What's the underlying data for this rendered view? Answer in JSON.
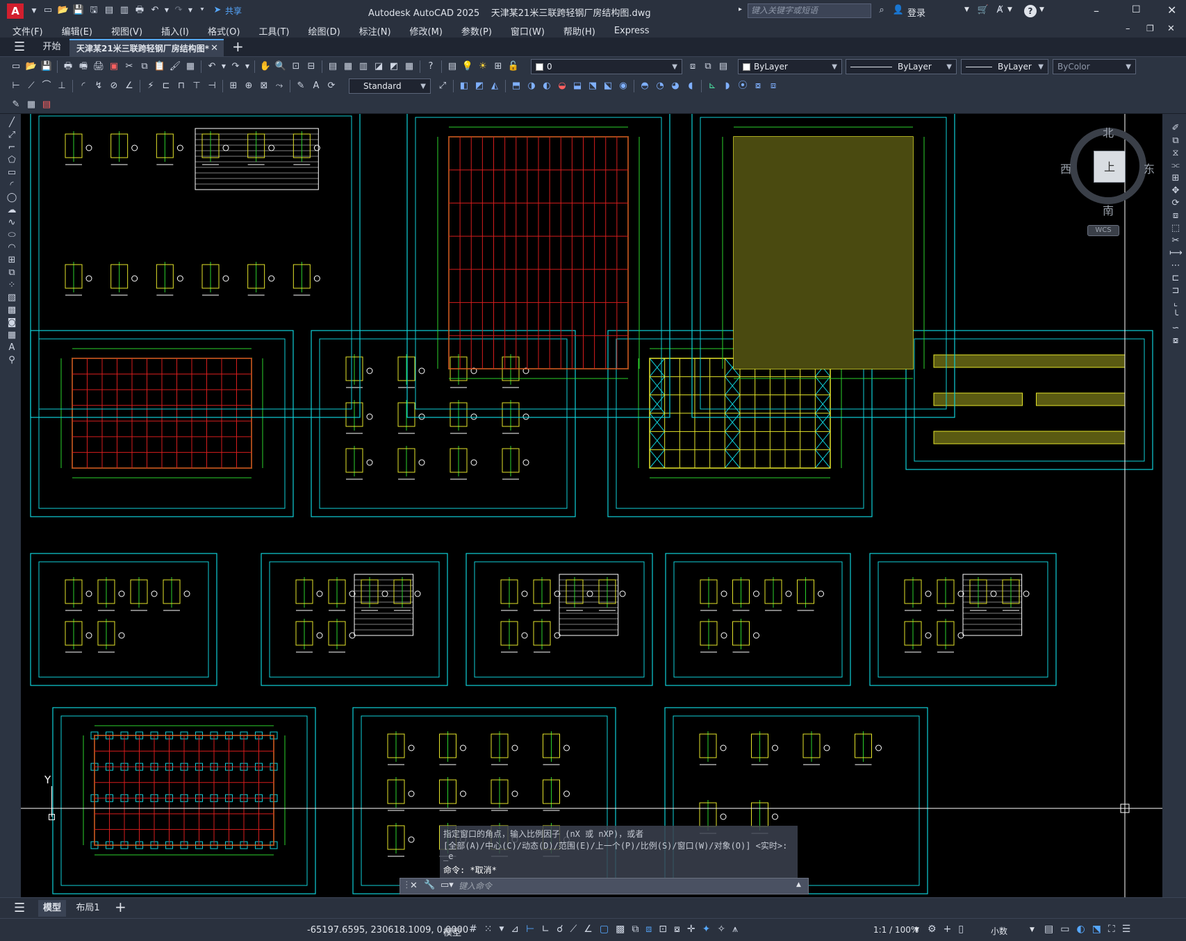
{
  "window": {
    "app_logo": "A",
    "title": "Autodesk AutoCAD 2025    天津某21米三联跨轻钢厂房结构图.dwg",
    "share_label": "共享",
    "search_placeholder": "键入关键字或短语",
    "signin_label": "登录",
    "controls": [
      "minimize-icon",
      "maximize-icon",
      "close-icon"
    ]
  },
  "menu": [
    "文件(F)",
    "编辑(E)",
    "视图(V)",
    "插入(I)",
    "格式(O)",
    "工具(T)",
    "绘图(D)",
    "标注(N)",
    "修改(M)",
    "参数(P)",
    "窗口(W)",
    "帮助(H)",
    "Express"
  ],
  "tabs": {
    "start": "开始",
    "active": "天津某21米三联跨轻钢厂房结构图*"
  },
  "toolbar": {
    "layer_value": "0",
    "color_value": "ByLayer",
    "linetype_value": "ByLayer",
    "lineweight_value": "ByLayer",
    "plotstyle_value": "ByColor",
    "textstyle_value": "Standard"
  },
  "viewcube": {
    "north": "北",
    "south": "南",
    "east": "东",
    "west": "西",
    "face": "上",
    "wcs": "WCS"
  },
  "ucs": {
    "y_label": "Y"
  },
  "command": {
    "line1": "指定窗口的角点，输入比例因子 (nX 或 nXP)，或者",
    "line2": "[全部(A)/中心(C)/动态(D)/范围(E)/上一个(P)/比例(S)/窗口(W)/对象(O)] <实时>: _e",
    "line3": "命令: *取消*",
    "input_placeholder": "键入命令"
  },
  "layouts": {
    "model": "模型",
    "layout1": "布局1"
  },
  "status": {
    "coordinates": "-65197.6595, 230618.1009, 0.0000",
    "space": "模型",
    "scale": "1:1 / 100%",
    "units": "小数"
  }
}
